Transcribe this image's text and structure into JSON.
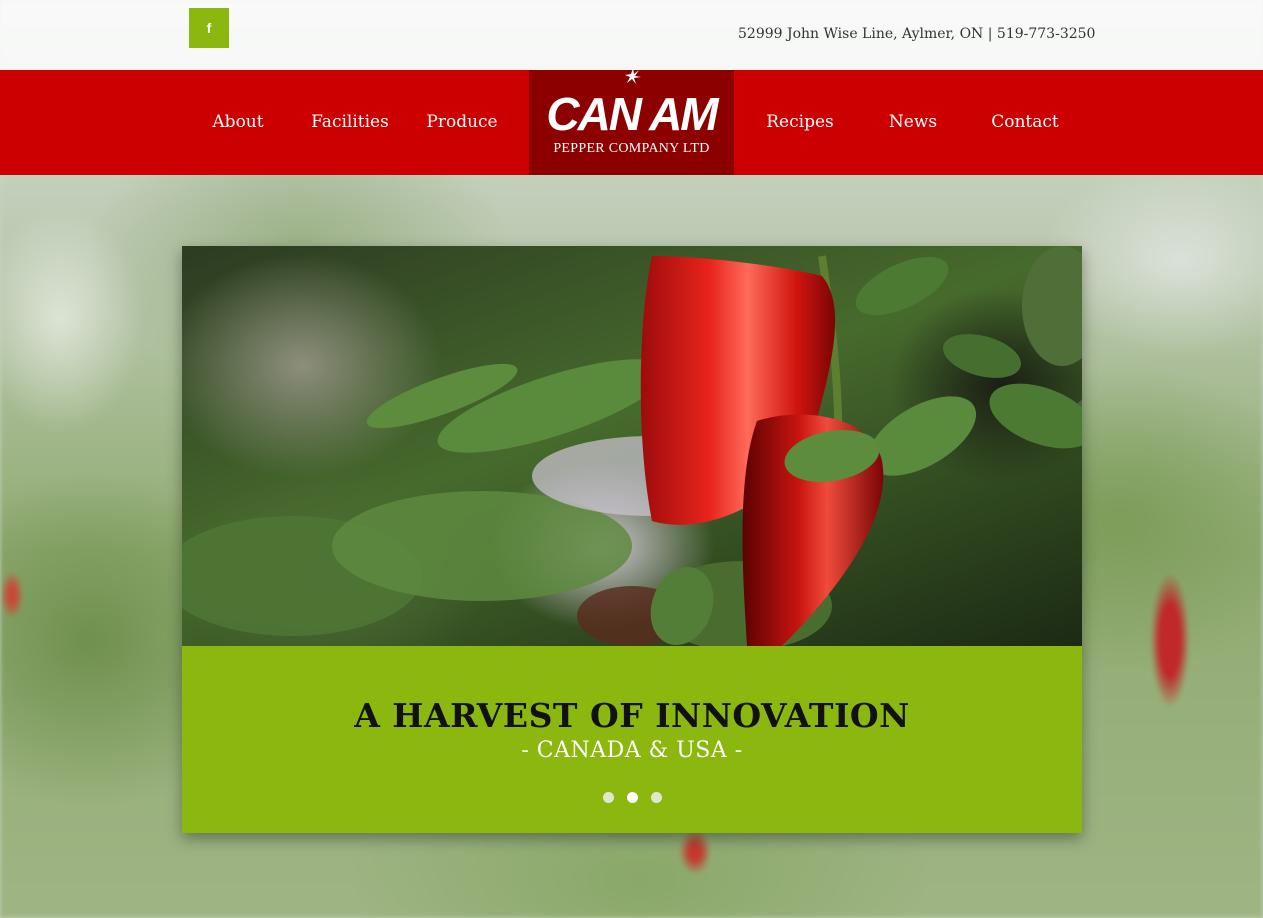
{
  "topbar": {
    "facebook_icon_glyph": "f",
    "contact_line": "52999 John Wise Line, Aylmer, ON | 519-773-3250"
  },
  "nav": {
    "left": [
      {
        "label": "About"
      },
      {
        "label": "Facilities"
      },
      {
        "label": "Produce"
      }
    ],
    "right": [
      {
        "label": "Recipes"
      },
      {
        "label": "News"
      },
      {
        "label": "Contact"
      }
    ]
  },
  "logo": {
    "main_text": "CAN AM",
    "sub_text": "PEPPER COMPANY LTD"
  },
  "slider": {
    "title": "A HARVEST OF INNOVATION",
    "subtitle": "- CANADA & USA -",
    "dots": 3,
    "active_dot": 2
  },
  "colors": {
    "nav_red": "#cc0000",
    "logo_dark_red": "#8c0000",
    "accent_green": "#8cb70f"
  },
  "icons": {
    "social": "facebook-icon"
  }
}
